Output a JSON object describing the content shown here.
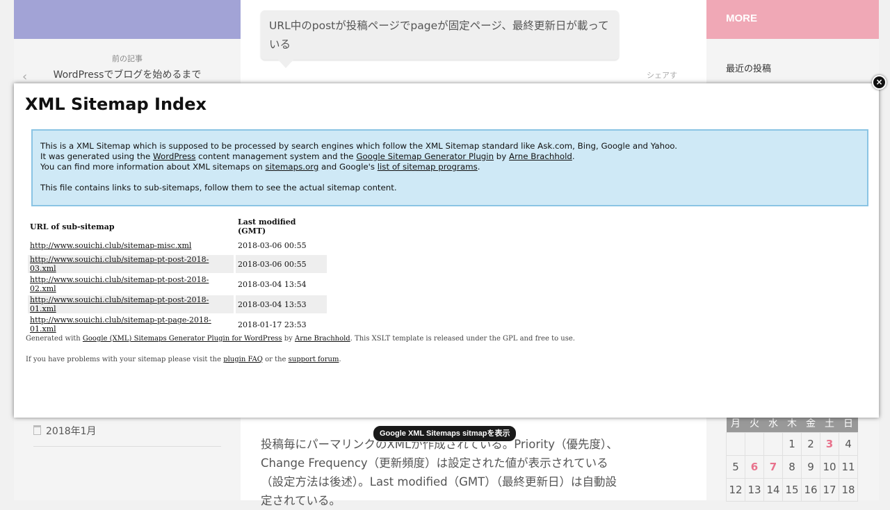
{
  "sidebar_left": {
    "prev_label": "前の記事",
    "prev_title": "WordPressでブログを始めるまで",
    "archive_item": "2018年1月"
  },
  "article": {
    "bubble_text": "URL中のpostが投稿ページでpageが固定ページ、最終更新日が載っている",
    "share_label": "シェアす",
    "body_text": "投稿毎にパーマリンクのXMLが作成されている。Priority（優先度）、Change Frequency（更新頻度）は設定された値が表示されている（設定方法は後述）。Last modified（GMT）（最終更新日）は自動設定されている。"
  },
  "sidebar_right": {
    "heading": "MORE",
    "recent_posts": "最近の投稿",
    "calendar": {
      "headers": [
        "月",
        "火",
        "水",
        "木",
        "金",
        "土",
        "日"
      ],
      "rows": [
        [
          "",
          "",
          "",
          "1",
          "2",
          "3",
          "4"
        ],
        [
          "5",
          "6",
          "7",
          "8",
          "9",
          "10",
          "11"
        ],
        [
          "12",
          "13",
          "14",
          "15",
          "16",
          "17",
          "18"
        ]
      ],
      "highlighted_days": [
        "3",
        "6",
        "7"
      ]
    }
  },
  "sitemap": {
    "title": "XML Sitemap Index",
    "intro": {
      "line1": "This is a XML Sitemap which is supposed to be processed by search engines which follow the XML Sitemap standard like Ask.com, Bing, Google and Yahoo.",
      "line2_a": "It was generated using the ",
      "link_wordpress": "WordPress",
      "line2_b": " content management system and the ",
      "link_plugin": "Google Sitemap Generator Plugin",
      "line2_c": " by ",
      "link_author": "Arne Brachhold",
      "line2_d": ".",
      "line3_a": "You can find more information about XML sitemaps on ",
      "link_sitemaps_org": "sitemaps.org",
      "line3_b": " and Google's ",
      "link_programs": "list of sitemap programs",
      "line3_c": ".",
      "line4": "This file contains links to sub-sitemaps, follow them to see the actual sitemap content."
    },
    "table": {
      "col_url": "URL of sub-sitemap",
      "col_modified": "Last modified (GMT)",
      "rows": [
        {
          "url": "http://www.souichi.club/sitemap-misc.xml",
          "modified": "2018-03-06 00:55"
        },
        {
          "url": "http://www.souichi.club/sitemap-pt-post-2018-03.xml",
          "modified": "2018-03-06 00:55"
        },
        {
          "url": "http://www.souichi.club/sitemap-pt-post-2018-02.xml",
          "modified": "2018-03-04 13:54"
        },
        {
          "url": "http://www.souichi.club/sitemap-pt-post-2018-01.xml",
          "modified": "2018-03-04 13:53"
        },
        {
          "url": "http://www.souichi.club/sitemap-pt-page-2018-01.xml",
          "modified": "2018-01-17 23:53"
        }
      ]
    },
    "footer": {
      "gen_a": "Generated with ",
      "gen_link_plugin": "Google (XML) Sitemaps Generator Plugin for WordPress",
      "gen_b": " by ",
      "gen_link_author": "Arne Brachhold",
      "gen_c": ". This XSLT template is released under the GPL and free to use.",
      "help_a": "If you have problems with your sitemap please visit the ",
      "help_link_faq": "plugin FAQ",
      "help_b": " or the ",
      "help_link_forum": "support forum",
      "help_c": "."
    }
  },
  "overlay_close": "×",
  "tooltip": "Google XML Sitemaps sitmapを表示"
}
